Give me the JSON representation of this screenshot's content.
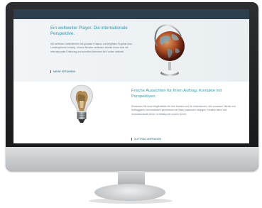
{
  "hero": {
    "title": "Ein weltweiter Player. Die internationale Perspektive.",
    "body": "Wir betreuen Unternehmen mit globaler Präsenz und begleiten Projekte über Landesgrenzen hinweg. Unsere Berater verbinden lokales Know-how mit internationaler Erfahrung und schaffen Mehrwert für Kunden weltweit.",
    "link": "MEHR ERFAHREN"
  },
  "section2": {
    "title": "Frische Aussichten für Ihren Auftrag. Kontakte mit Perspektiven.",
    "body": "Entdecken Sie neue Möglichkeiten für Ihre Karriere und Ihr Unternehmen. Wir vernetzen Talente und Auftraggeber und entwickeln gemeinsam mit Ihnen passende Lösungen. Kreative Ideen und Innovationskraft stehen im Mittelpunkt unserer Arbeit.",
    "link": "AUFTRAG ANFRAGEN"
  },
  "colors": {
    "accent": "#2a9bb4",
    "header": "#2e3e4c"
  },
  "icons": [
    "globe-image",
    "lightbulb-image"
  ]
}
